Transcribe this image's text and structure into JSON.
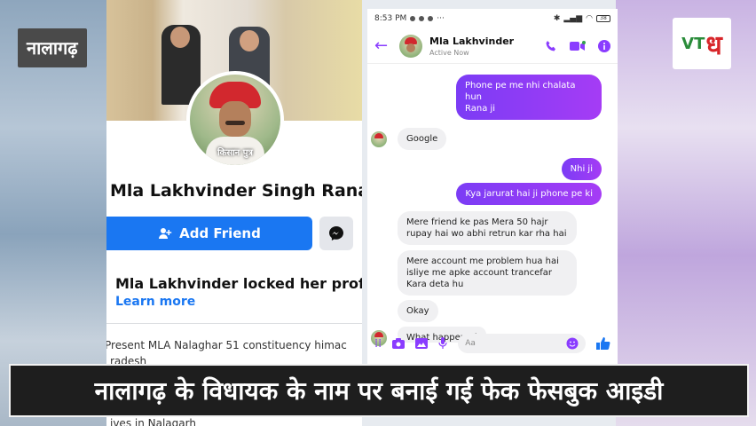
{
  "overlay": {
    "location_tag": "नालागढ़",
    "caption": "नालागढ़ के विधायक के नाम पर बनाई गई फेक फेसबुक आइडी",
    "logo": {
      "v": "V",
      "t": "T",
      "big": "ध"
    }
  },
  "facebook_profile": {
    "avatar_caption": "किसान पुत्र",
    "name": "Mla Lakhvinder Singh Rana",
    "add_friend_label": "Add Friend",
    "locked_title": "Mla Lakhvinder locked her profi",
    "learn_more": "Learn more",
    "bio_line1": "Present MLA Nalaghar 51 constituency himac",
    "bio_line2": "radesh",
    "bio_line3": "ives in Nalagarh"
  },
  "messenger": {
    "status_time": "8:53 PM",
    "battery": "38",
    "contact_name": "Mla Lakhvinder",
    "contact_status": "Active Now",
    "composer_placeholder": "Aa",
    "messages": [
      {
        "from": "me",
        "text": "Phone pe me nhi chalata hun\nRana ji"
      },
      {
        "from": "them",
        "text": "Google"
      },
      {
        "from": "me",
        "text": "Nhi ji"
      },
      {
        "from": "me",
        "text": "Kya jarurat hai ji phone pe ki"
      },
      {
        "from": "them",
        "text": "Mere friend ke pas Mera 50 hajr\nrupay hai wo abhi retrun kar rha hai"
      },
      {
        "from": "them",
        "text": "Mere account me problem hua hai\nisliye me apke account trancefar\nKara deta hu"
      },
      {
        "from": "them",
        "text": "Okay"
      },
      {
        "from": "them",
        "text": "What happened"
      }
    ]
  },
  "colors": {
    "messenger_accent": "#8a3cff",
    "facebook_blue": "#1a77f2",
    "caption_bg": "#1e1e1e"
  }
}
